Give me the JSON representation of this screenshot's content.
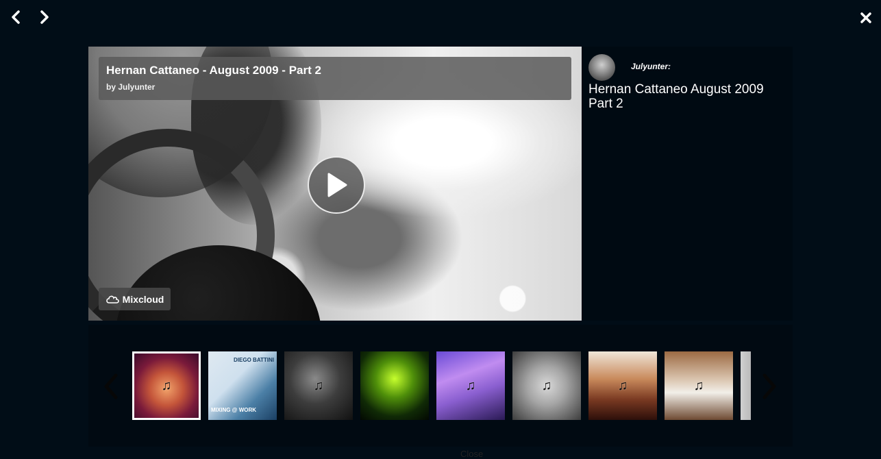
{
  "nav": {
    "prev_icon": "chevron-left-icon",
    "next_icon": "chevron-right-icon",
    "close_icon": "close-icon"
  },
  "player": {
    "title": "Hernan Cattaneo - August 2009 - Part 2",
    "byline": "by Julyunter",
    "play_icon": "play-icon",
    "badge_icon": "cloud-icon",
    "badge_label": "Mixcloud"
  },
  "info": {
    "username": "Julyunter:",
    "description": "Hernan Cattaneo August 2009 Part 2"
  },
  "carousel": {
    "prev_icon": "chevron-left-icon",
    "next_icon": "chevron-right-icon",
    "thumbnails": [
      {
        "icon": "music-note-icon",
        "active": true,
        "bg": "radial-gradient(circle at 50% 55%, #f2a36a 0, #c4553a 35%, #7a1a3a 65%, #3b0a2a 100%)"
      },
      {
        "icon": "",
        "active": false,
        "bg": "linear-gradient(135deg, #dfe9f1 0%, #cfe0ee 40%, #4b7fa6 70%, #1a3f63 100%)",
        "text": "DIEGO BATTINI",
        "text2": "MIXING @ WORK"
      },
      {
        "icon": "music-note-icon",
        "active": false,
        "bg": "radial-gradient(circle at 45% 40%, #8a8a8a 0, #3d3d3d 45%, #111 100%)"
      },
      {
        "icon": "",
        "active": false,
        "bg": "radial-gradient(circle at 50% 40%, #c6ff2d 0, #4f8f0a 35%, #102a06 70%, #020802 100%)"
      },
      {
        "icon": "music-note-icon",
        "active": false,
        "bg": "linear-gradient(160deg, #6a4bd6 0%, #c08cf0 35%, #8a5fd0 60%, #2a1a55 100%)"
      },
      {
        "icon": "music-note-icon",
        "active": false,
        "bg": "radial-gradient(ellipse at 50% 50%, #d9d9d9 0, #a5a5a5 40%, #3d3d3d 100%)"
      },
      {
        "icon": "music-note-icon",
        "active": false,
        "bg": "linear-gradient(180deg, #efe5d8 0%, #c98a5c 40%, #7a3a22 70%, #2d0f0a 100%)"
      },
      {
        "icon": "music-note-icon",
        "active": false,
        "bg": "linear-gradient(180deg, #9c6a43 0%, #d9c3ad 40%, #f2efe9 60%, #6e4a32 100%)"
      },
      {
        "icon": "",
        "active": false,
        "bg": "linear-gradient(90deg, #d0d0d0 0%, #3a3a3a 100%)"
      }
    ]
  },
  "footer": {
    "close_label": "Close"
  },
  "colors": {
    "background": "#010d17",
    "panel": "#000a12",
    "title_box": "#5a5a5a"
  }
}
